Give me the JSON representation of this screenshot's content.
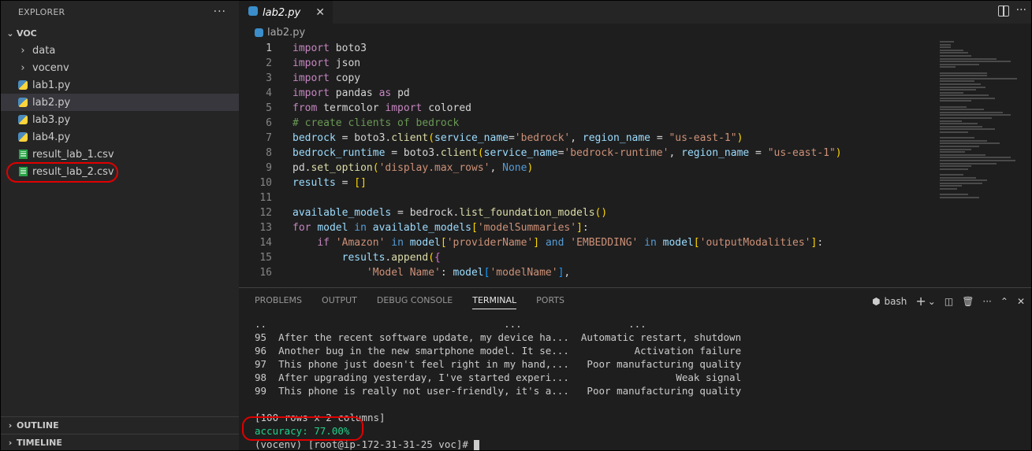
{
  "explorer": {
    "title": "EXPLORER",
    "more": "···",
    "folder": "VOC",
    "items": [
      {
        "label": "data",
        "type": "folder"
      },
      {
        "label": "vocenv",
        "type": "folder"
      },
      {
        "label": "lab1.py",
        "type": "py"
      },
      {
        "label": "lab2.py",
        "type": "py"
      },
      {
        "label": "lab3.py",
        "type": "py"
      },
      {
        "label": "lab4.py",
        "type": "py"
      },
      {
        "label": "result_lab_1.csv",
        "type": "csv"
      },
      {
        "label": "result_lab_2.csv",
        "type": "csv"
      }
    ],
    "outline": "OUTLINE",
    "timeline": "TIMELINE"
  },
  "editor": {
    "tab": {
      "name": "lab2.py",
      "close": "✕"
    },
    "more": "···",
    "breadcrumb": "lab2.py",
    "line_numbers": [
      "1",
      "2",
      "3",
      "4",
      "5",
      "6",
      "7",
      "8",
      "9",
      "10",
      "11",
      "12",
      "13",
      "14",
      "15",
      "16"
    ]
  },
  "panel": {
    "tabs": [
      "PROBLEMS",
      "OUTPUT",
      "DEBUG CONSOLE",
      "TERMINAL",
      "PORTS"
    ],
    "active_tab": "TERMINAL",
    "shell": "bash",
    "terminal_lines": [
      "..                                        ...                  ...",
      "95  After the recent software update, my device ha...  Automatic restart, shutdown",
      "96  Another bug in the new smartphone model. It se...           Activation failure",
      "97  This phone just doesn't feel right in my hand,...   Poor manufacturing quality",
      "98  After upgrading yesterday, I've started experi...                  Weak signal",
      "99  This phone is really not user-friendly, it's a...   Poor manufacturing quality",
      "",
      "[100 rows x 2 columns]"
    ],
    "accuracy": "accuracy: 77.00%",
    "prompt": "(vocenv) [root@ip-172-31-31-25 voc]# "
  }
}
